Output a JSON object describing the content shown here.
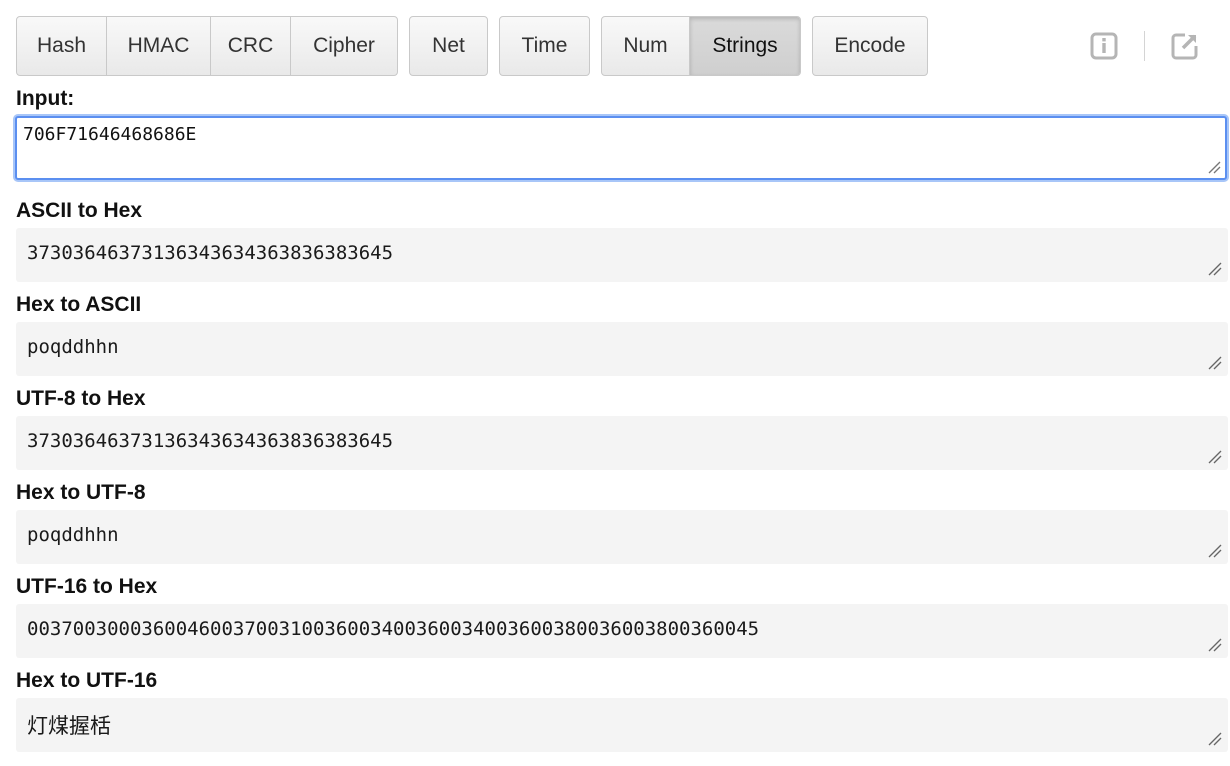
{
  "toolbar": {
    "group1": [
      "Hash",
      "HMAC",
      "CRC",
      "Cipher"
    ],
    "group2": [
      "Net"
    ],
    "group3": [
      "Time"
    ],
    "group4": [
      "Num",
      "Strings"
    ],
    "group5": [
      "Encode"
    ],
    "active": "Strings"
  },
  "icons": {
    "info": "info-icon",
    "popout": "external-link-icon"
  },
  "input": {
    "label": "Input:",
    "value": "706F71646468686E"
  },
  "outputs": [
    {
      "label": "ASCII to Hex",
      "value": "37303646373136343634363836383645"
    },
    {
      "label": "Hex to ASCII",
      "value": "poqddhhn"
    },
    {
      "label": "UTF-8 to Hex",
      "value": "37303646373136343634363836383645"
    },
    {
      "label": "Hex to UTF-8",
      "value": "poqddhhn"
    },
    {
      "label": "UTF-16 to Hex",
      "value": "0037003000360046003700310036003400360034003600380036003800360045"
    },
    {
      "label": "Hex to UTF-16",
      "value": "灯煤握栝"
    }
  ],
  "colors": {
    "focus_border": "#5b8ff0",
    "output_bg": "#f4f4f4",
    "active_button": "#d4d4d4"
  }
}
